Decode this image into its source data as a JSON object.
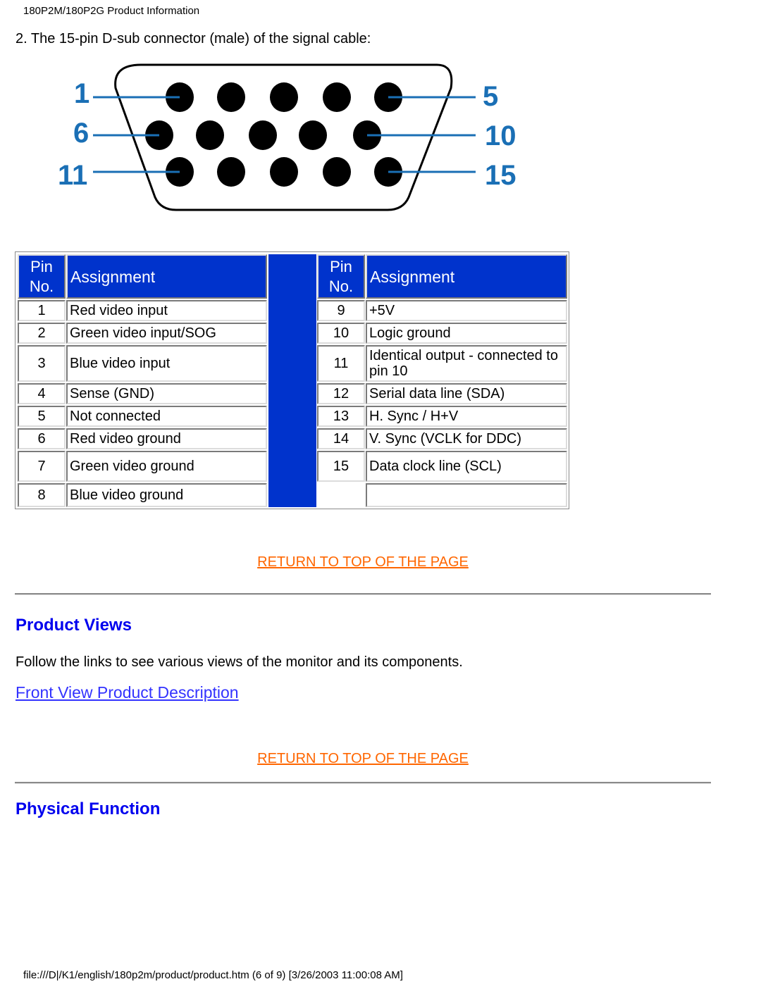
{
  "header": {
    "title": "180P2M/180P2G Product Information"
  },
  "intro": "2. The 15-pin D-sub connector (male) of the signal cable:",
  "connector": {
    "labels": {
      "row1_left": "1",
      "row1_right": "5",
      "row2_left": "6",
      "row2_right": "10",
      "row3_left": "11",
      "row3_right": "15"
    },
    "pins_per_row": [
      5,
      5,
      5
    ],
    "label_color": "#1a6fb5"
  },
  "table": {
    "header": {
      "pin": [
        "Pin",
        "No."
      ],
      "assignment": "Assignment"
    },
    "left_rows": [
      {
        "pin": "1",
        "assignment": "Red video input"
      },
      {
        "pin": "2",
        "assignment": "Green video input/SOG"
      },
      {
        "pin": "3",
        "assignment": "Blue video input"
      },
      {
        "pin": "4",
        "assignment": "Sense (GND)"
      },
      {
        "pin": "5",
        "assignment": "Not connected"
      },
      {
        "pin": "6",
        "assignment": "Red video ground"
      },
      {
        "pin": "7",
        "assignment": "Green video ground"
      },
      {
        "pin": "8",
        "assignment": "Blue video ground"
      }
    ],
    "right_rows": [
      {
        "pin": "9",
        "assignment": "+5V"
      },
      {
        "pin": "10",
        "assignment": "Logic ground"
      },
      {
        "pin": "11",
        "assignment": "Identical output - connected to pin 10"
      },
      {
        "pin": "12",
        "assignment": "Serial data line (SDA)"
      },
      {
        "pin": "13",
        "assignment": "H. Sync / H+V"
      },
      {
        "pin": "14",
        "assignment": "V. Sync (VCLK for DDC)"
      },
      {
        "pin": "15",
        "assignment": "Data clock line (SCL)"
      },
      {
        "pin": "",
        "assignment": ""
      }
    ],
    "header_color": "#0033cc"
  },
  "return_link": "RETURN TO TOP OF THE PAGE",
  "product_views": {
    "title": "Product Views",
    "text": "Follow the links to see various views of the monitor and its components.",
    "link": "Front View Product Description"
  },
  "physical_function": {
    "title": "Physical Function"
  },
  "footer": "file:///D|/K1/english/180p2m/product/product.htm (6 of 9) [3/26/2003 11:00:08 AM]"
}
